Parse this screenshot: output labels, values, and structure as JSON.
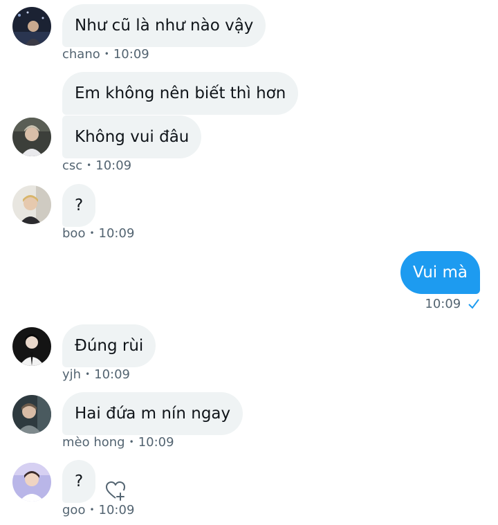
{
  "messages": [
    {
      "text": "Như cũ là như nào vậy",
      "sender": "chano",
      "time": "10:09"
    },
    {
      "text": "Em không nên biết thì hơn"
    },
    {
      "text": "Không vui đâu",
      "sender": "csc",
      "time": "10:09"
    },
    {
      "text": "?",
      "sender": "boo",
      "time": "10:09"
    },
    {
      "text": "Vui mà",
      "time": "10:09"
    },
    {
      "text": "Đúng rùi",
      "sender": "yjh",
      "time": "10:09"
    },
    {
      "text": "Hai đứa m nín ngay",
      "sender": "mèo hong",
      "time": "10:09"
    },
    {
      "text": "?",
      "sender": "goo",
      "time": "10:09"
    }
  ],
  "separator": "•",
  "colors": {
    "received_bubble": "#eff3f4",
    "sent_bubble": "#1d9bf0",
    "meta_text": "#536471",
    "read_check": "#1d9bf0"
  },
  "icons": {
    "read_receipt": "check-icon",
    "reaction": "heart-plus-icon"
  }
}
